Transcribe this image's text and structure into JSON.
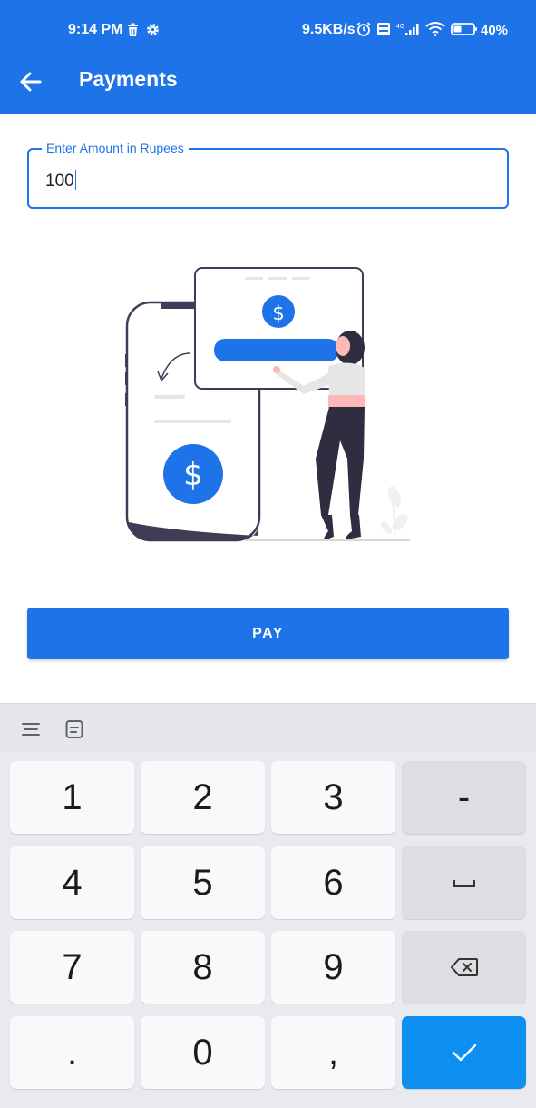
{
  "status_bar": {
    "time": "9:14 PM",
    "network_speed": "9.5KB/s",
    "battery_percent": "40%",
    "icons": [
      "delete-icon",
      "gear-icon",
      "alarm-icon",
      "volte-icon",
      "signal-4g-icon",
      "wifi-icon",
      "battery-icon"
    ]
  },
  "app_bar": {
    "title": "Payments",
    "back_icon": "arrow-left-icon"
  },
  "amount_field": {
    "label": "Enter Amount in Rupees",
    "value": "100"
  },
  "illustration": {
    "dollar_symbol": "$"
  },
  "pay_button": {
    "label": "PAY"
  },
  "keyboard": {
    "toolbar_icons": [
      "menu-lines-icon",
      "clipboard-icon"
    ],
    "keys": {
      "k1": "1",
      "k2": "2",
      "k3": "3",
      "minus": "-",
      "k4": "4",
      "k5": "5",
      "k6": "6",
      "k7": "7",
      "k8": "8",
      "k9": "9",
      "dot": ".",
      "k0": "0",
      "comma": ","
    }
  },
  "colors": {
    "primary": "#1f73e8",
    "enter_key": "#0d8ff2",
    "keyboard_bg": "#e8eaed"
  }
}
